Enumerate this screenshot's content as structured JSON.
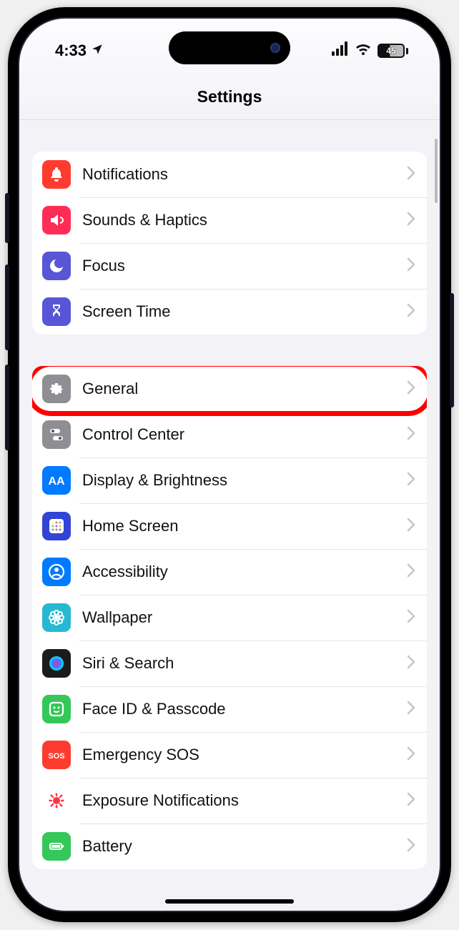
{
  "status": {
    "time": "4:33",
    "battery_pct": "45"
  },
  "header": {
    "title": "Settings"
  },
  "groups": [
    {
      "rows": [
        {
          "id": "notifications",
          "label": "Notifications",
          "icon": "bell-icon",
          "color": "#ff3b30"
        },
        {
          "id": "sounds",
          "label": "Sounds & Haptics",
          "icon": "speaker-icon",
          "color": "#ff2d55"
        },
        {
          "id": "focus",
          "label": "Focus",
          "icon": "moon-icon",
          "color": "#5856d6"
        },
        {
          "id": "screen-time",
          "label": "Screen Time",
          "icon": "hourglass-icon",
          "color": "#5856d6"
        }
      ]
    },
    {
      "rows": [
        {
          "id": "general",
          "label": "General",
          "icon": "gear-icon",
          "color": "#8e8e93",
          "highlighted": true
        },
        {
          "id": "control-center",
          "label": "Control Center",
          "icon": "switches-icon",
          "color": "#8e8e93"
        },
        {
          "id": "display",
          "label": "Display & Brightness",
          "icon": "text-size-icon",
          "color": "#007aff"
        },
        {
          "id": "home-screen",
          "label": "Home Screen",
          "icon": "grid-icon",
          "color": "#3244d6"
        },
        {
          "id": "accessibility",
          "label": "Accessibility",
          "icon": "person-circle-icon",
          "color": "#007aff"
        },
        {
          "id": "wallpaper",
          "label": "Wallpaper",
          "icon": "flower-icon",
          "color": "#27b9d4"
        },
        {
          "id": "siri",
          "label": "Siri & Search",
          "icon": "siri-icon",
          "color": "#1b1b1d"
        },
        {
          "id": "faceid",
          "label": "Face ID & Passcode",
          "icon": "face-id-icon",
          "color": "#34c759"
        },
        {
          "id": "sos",
          "label": "Emergency SOS",
          "icon": "sos-icon",
          "color": "#ff3b30"
        },
        {
          "id": "exposure",
          "label": "Exposure Notifications",
          "icon": "virus-icon",
          "color": "#ffffff",
          "fg": "#ff3348"
        },
        {
          "id": "battery",
          "label": "Battery",
          "icon": "battery-icon",
          "color": "#34c759"
        }
      ]
    }
  ]
}
